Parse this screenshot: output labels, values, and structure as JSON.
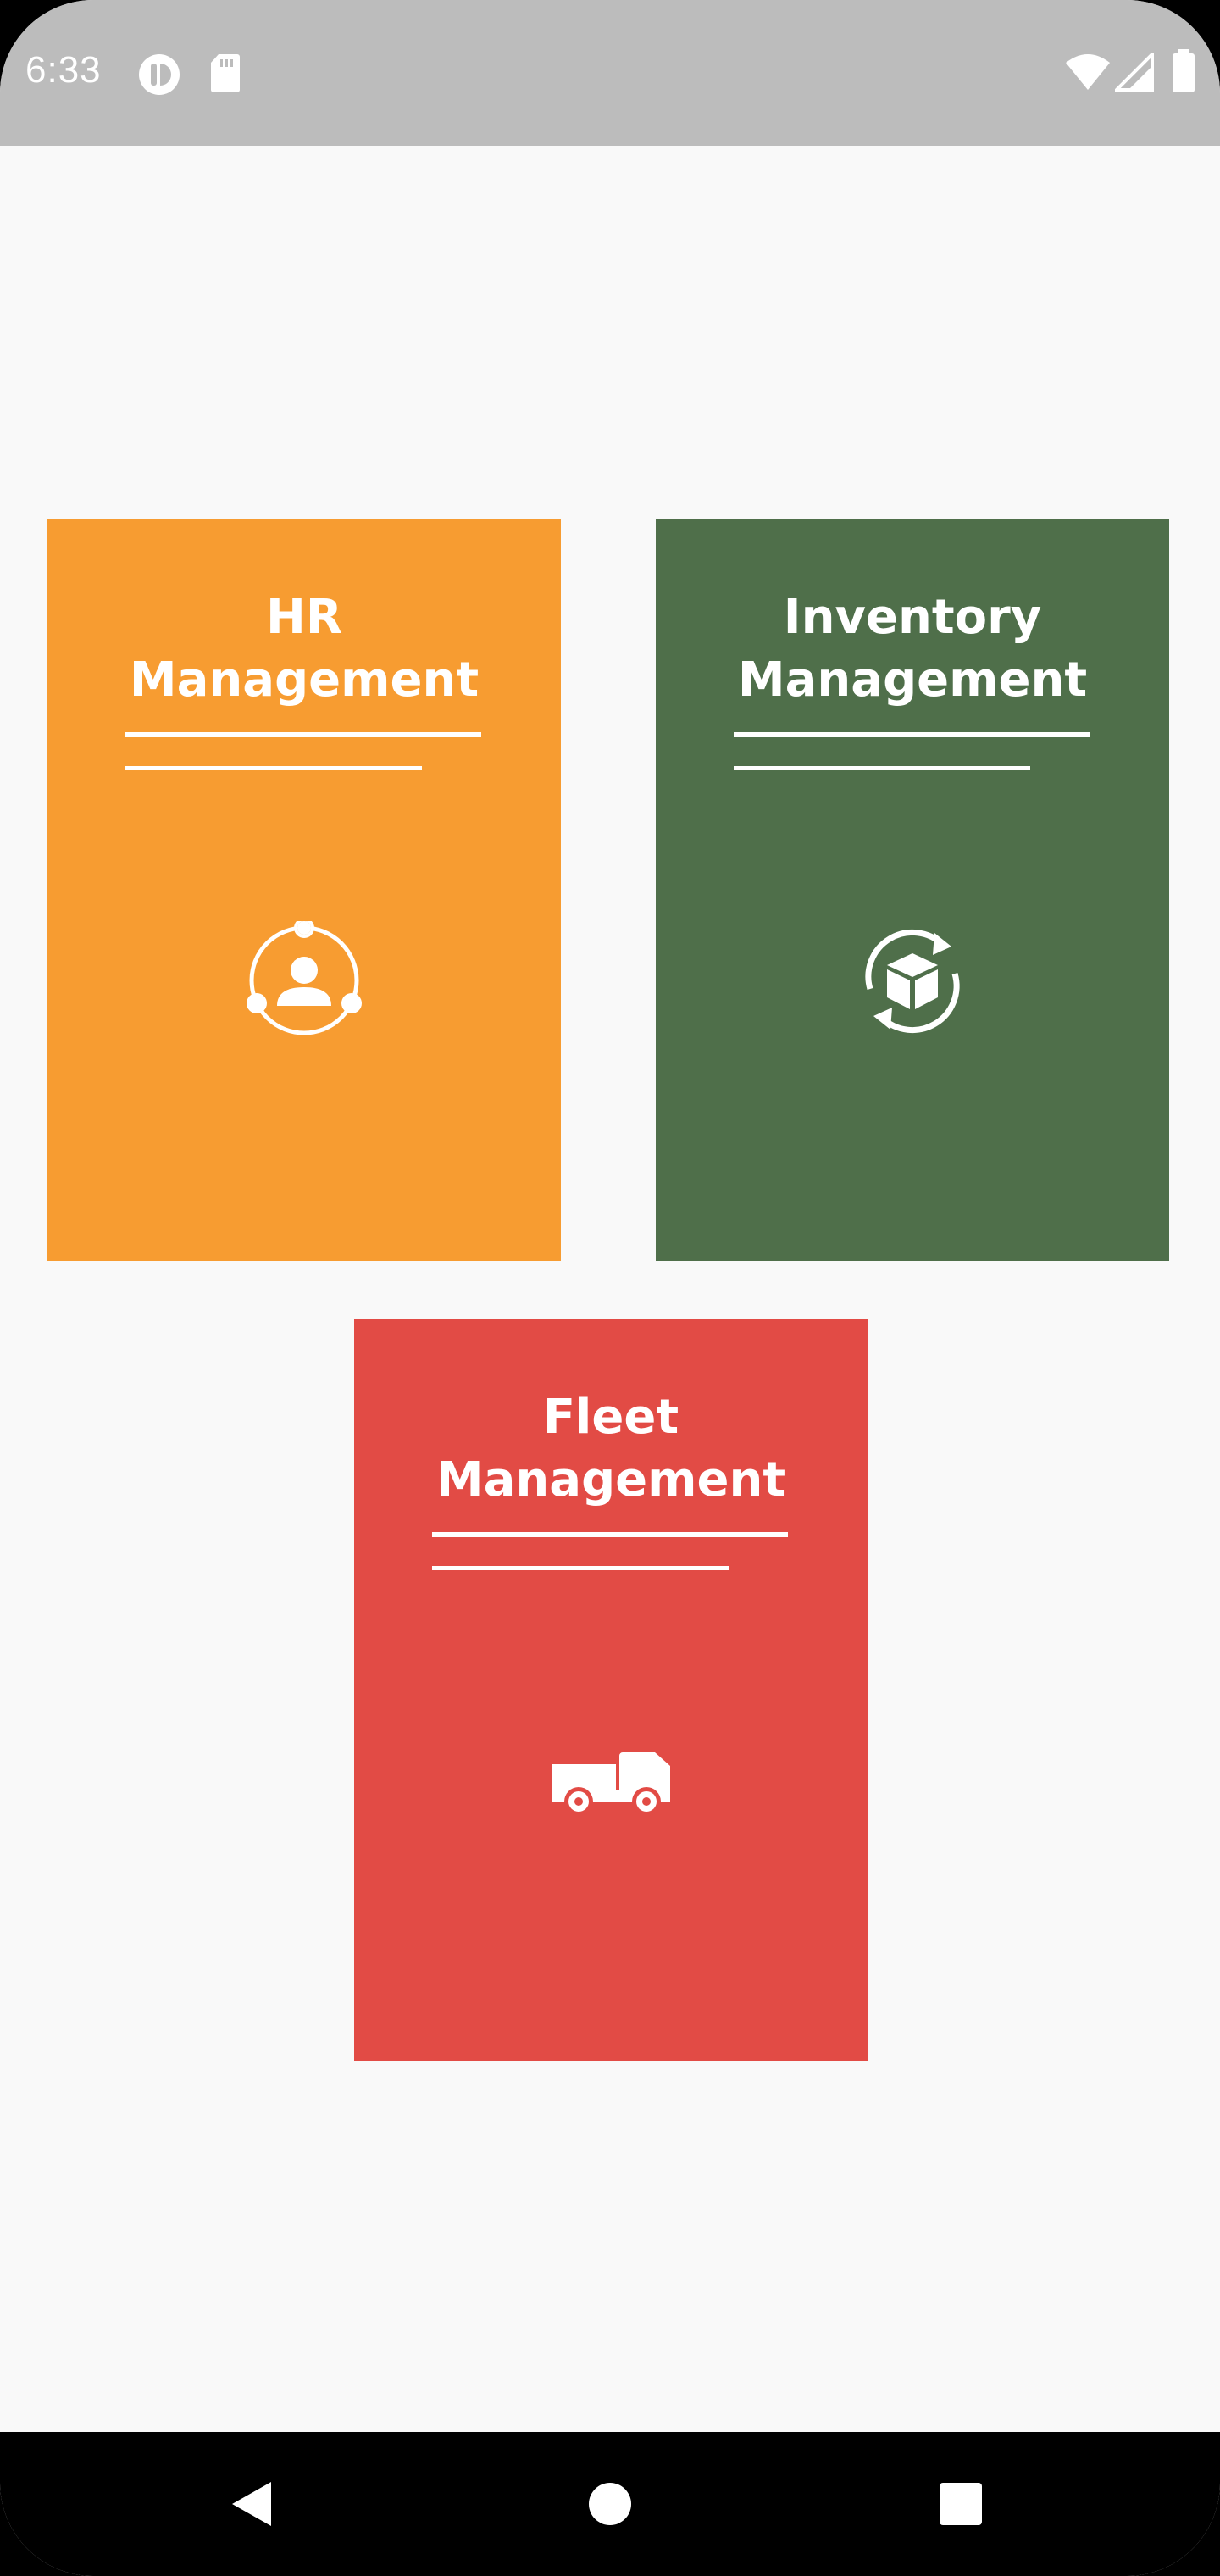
{
  "status_bar": {
    "time": "6:33",
    "icons": [
      "notification-app-icon",
      "sd-card-icon",
      "wifi-icon",
      "signal-icon",
      "battery-icon"
    ]
  },
  "colors": {
    "status_bar_bg": "#bcbcbc",
    "page_bg": "#f9f9f9",
    "hr_card": "#f79c31",
    "inventory_card": "#4f6f4a",
    "fleet_card": "#e24b45",
    "nav_bar_bg": "#000000"
  },
  "cards": {
    "hr": {
      "title_line1": "HR",
      "title_line2": "Management",
      "icon": "people-network-icon"
    },
    "inventory": {
      "title_line1": "Inventory",
      "title_line2": "Management",
      "icon": "box-sync-icon"
    },
    "fleet": {
      "title_line1": "Fleet",
      "title_line2": "Management",
      "icon": "truck-icon"
    }
  },
  "nav_bar": {
    "buttons": [
      "back-icon",
      "home-icon",
      "recents-icon"
    ]
  }
}
